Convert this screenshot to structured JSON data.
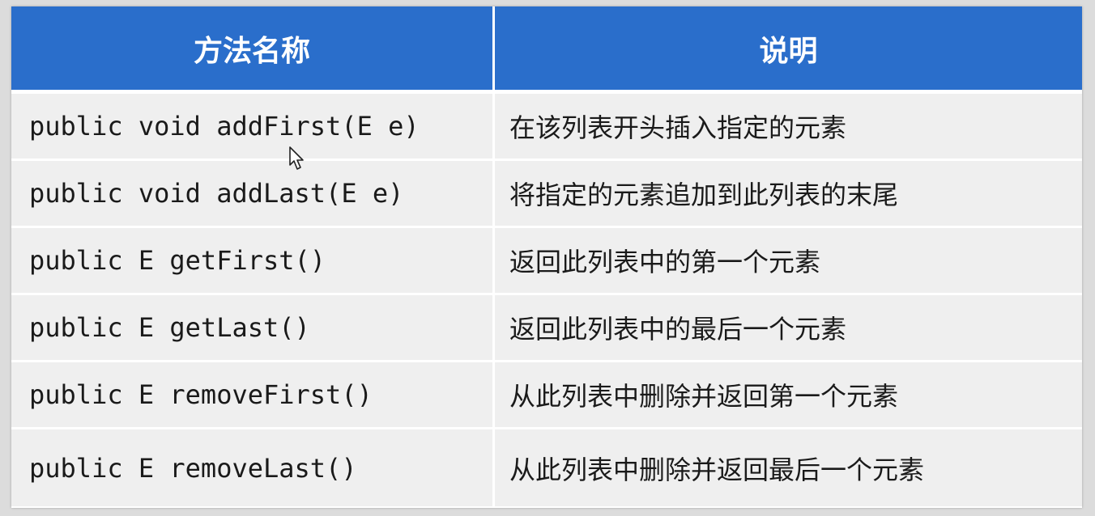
{
  "table": {
    "headers": [
      "方法名称",
      "说明"
    ],
    "rows": [
      {
        "method": "public void addFirst(E e)",
        "description": "在该列表开头插入指定的元素"
      },
      {
        "method": "public void addLast(E e)",
        "description": "将指定的元素追加到此列表的末尾"
      },
      {
        "method": "public E getFirst()",
        "description": "返回此列表中的第一个元素"
      },
      {
        "method": "public E getLast()",
        "description": "返回此列表中的最后一个元素"
      },
      {
        "method": "public E removeFirst()",
        "description": "从此列表中删除并返回第一个元素"
      },
      {
        "method": "public E removeLast()",
        "description": "从此列表中删除并返回最后一个元素"
      }
    ]
  },
  "colors": {
    "header_bg": "#2a6ecb",
    "header_text": "#ffffff",
    "row_bg": "#efefef"
  },
  "icons": {
    "cursor": "mouse-pointer-icon"
  }
}
